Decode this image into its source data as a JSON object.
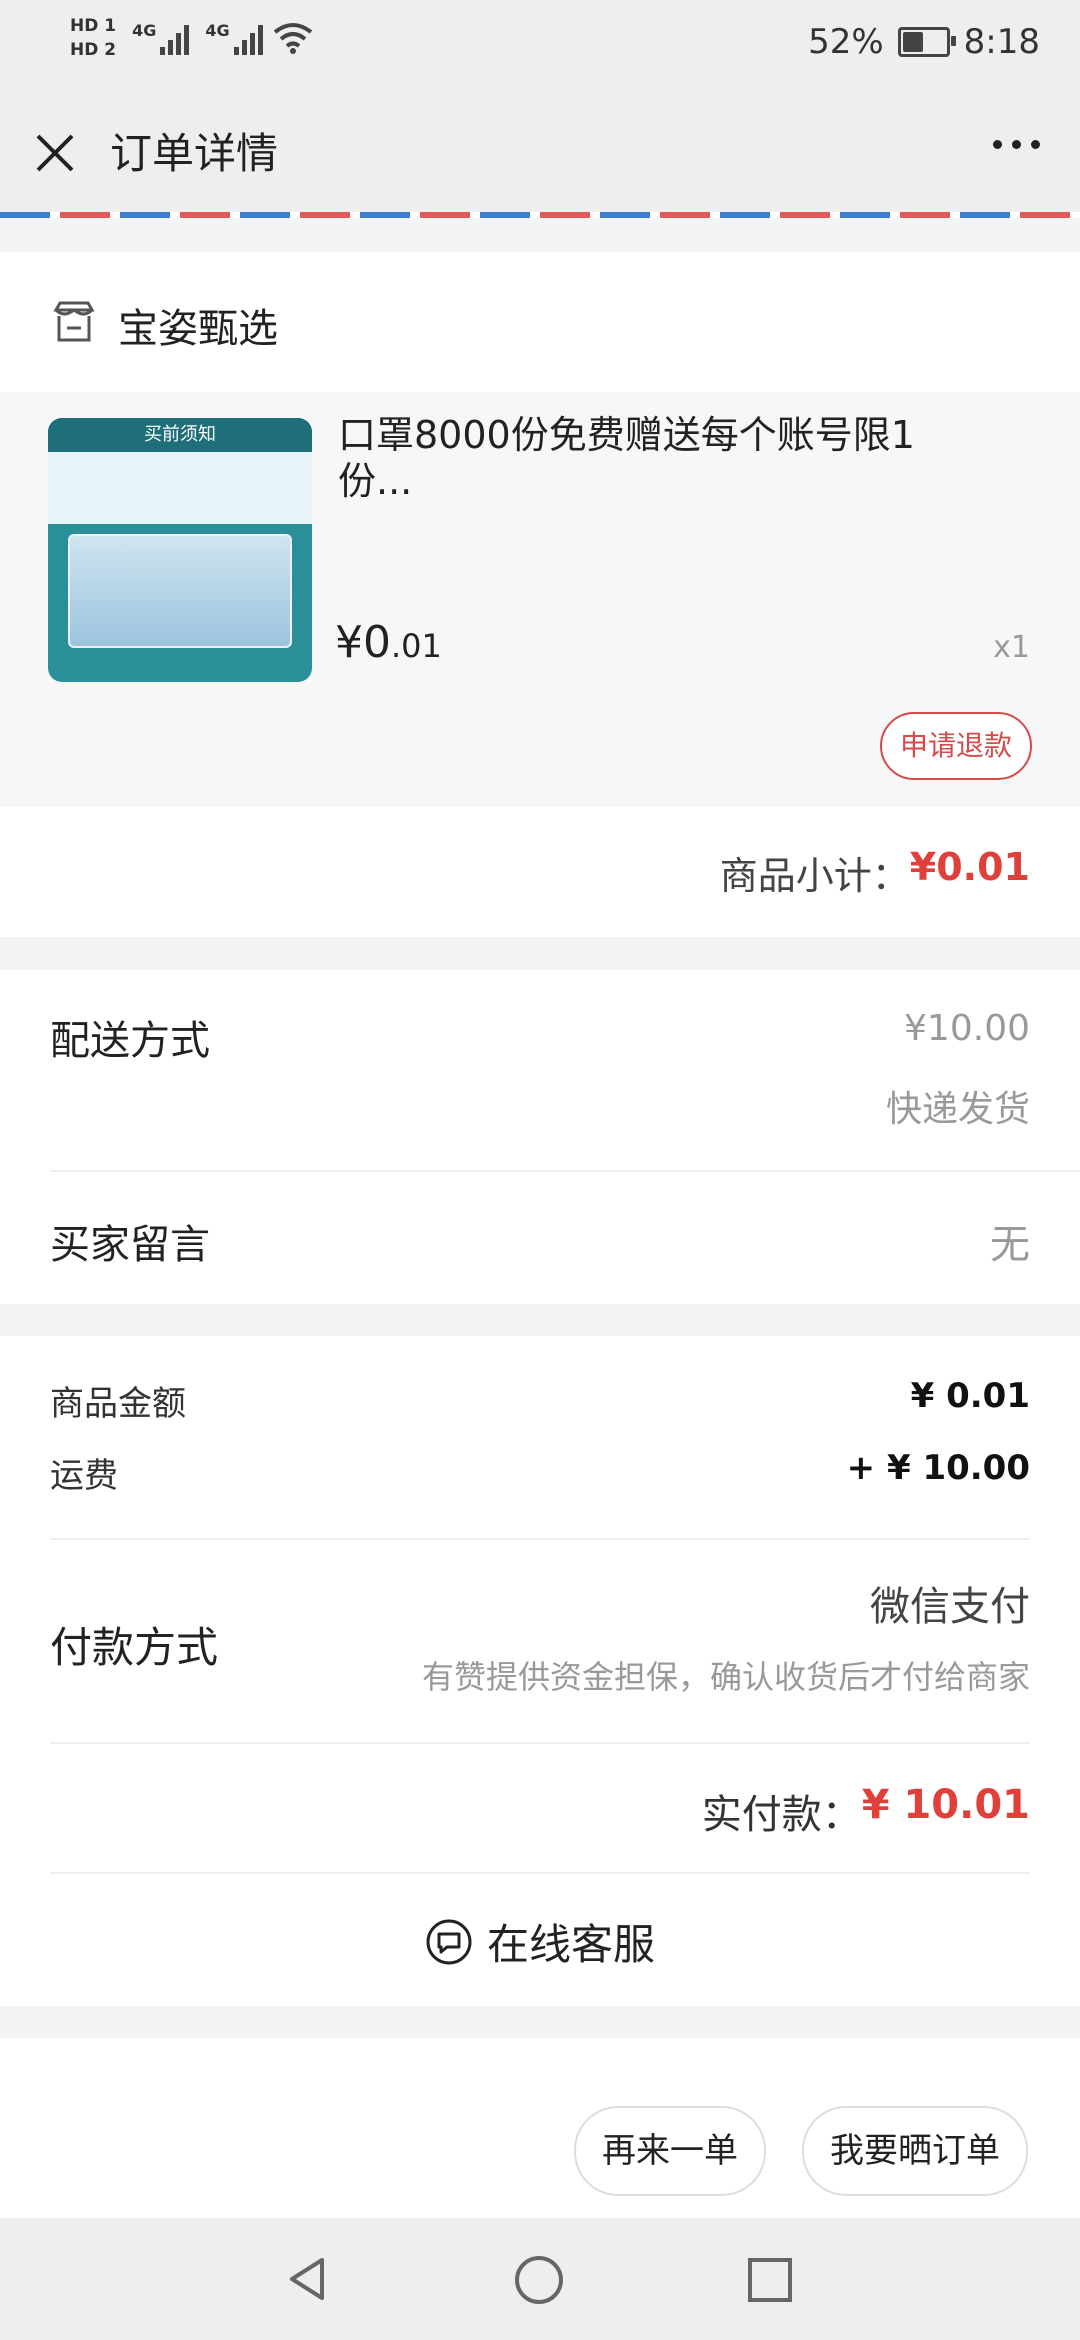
{
  "status_bar": {
    "hd1": "HD 1",
    "hd2": "HD 2",
    "network1": "4G",
    "network2": "4G",
    "battery_percent": "52%",
    "battery_level": 0.52,
    "time": "8:18"
  },
  "header": {
    "title": "订单详情"
  },
  "store": {
    "name": "宝姿甄选"
  },
  "goods": {
    "image_banner": "买前须知",
    "title": "口罩8000份免费赠送每个账号限1份...",
    "price_symbol_int": "¥0",
    "price_decimal": ".01",
    "quantity": "x1",
    "refund_label": "申请退款"
  },
  "subtotal": {
    "label": "商品小计：",
    "value": "¥0.01"
  },
  "delivery": {
    "label": "配送方式",
    "fee": "¥10.00",
    "method": "快递发货",
    "message_label": "买家留言",
    "message_value": "无"
  },
  "summary": {
    "goods_amount_label": "商品金额",
    "goods_amount_value": "¥ 0.01",
    "shipping_label": "运费",
    "shipping_value": "+ ¥ 10.00",
    "payment_label": "付款方式",
    "payment_method": "微信支付",
    "payment_note": "有赞提供资金担保，确认收货后才付给商家",
    "paid_label": "实付款：",
    "paid_value": "¥ 10.01",
    "service_label": "在线客服"
  },
  "actions": {
    "reorder": "再来一单",
    "share": "我要晒订单"
  },
  "colors": {
    "accent_red": "#e0403a",
    "refund_red": "#d64a4a",
    "envelope_blue": "#3f7fd0"
  }
}
